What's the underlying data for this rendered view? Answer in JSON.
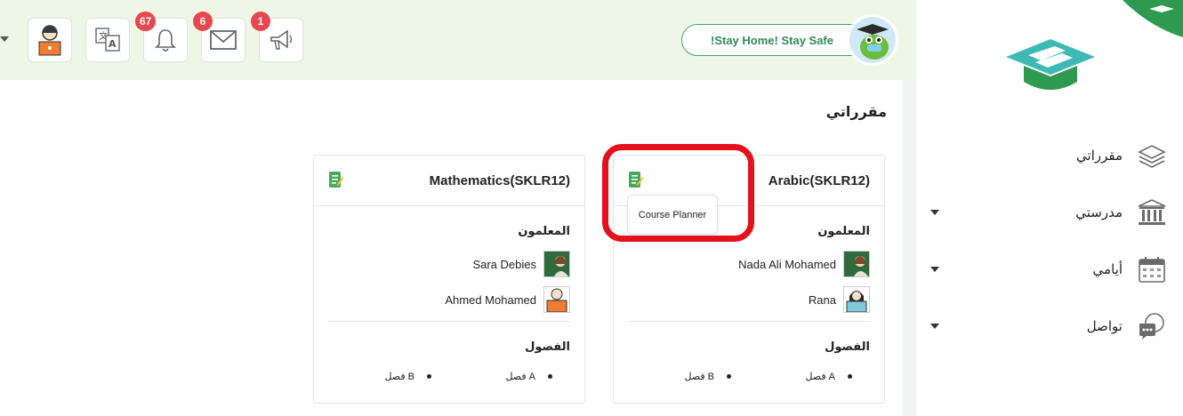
{
  "topbar": {
    "badges": {
      "notifications": "67",
      "messages": "6",
      "announcements": "1"
    },
    "stay_home": "!Stay Home! Stay Safe"
  },
  "main": {
    "title": "مقرراتي",
    "tooltip": "Course Planner",
    "courses": [
      {
        "title": "Mathematics(SKLR12)",
        "teachers_label": "المعلمون",
        "teachers": [
          "Sara Debies",
          "Ahmed Mohamed"
        ],
        "classes_label": "الفصول",
        "classes": [
          "فصل A",
          "فصل B"
        ]
      },
      {
        "title": "Arabic(SKLR12)",
        "teachers_label": "المعلمون",
        "teachers": [
          "Nada Ali Mohamed",
          "Rana"
        ],
        "classes_label": "الفصول",
        "classes": [
          "فصل A",
          "فصل B"
        ]
      }
    ]
  },
  "sidebar": {
    "items": [
      {
        "label": "مقرراتي",
        "icon": "layers-icon"
      },
      {
        "label": "مدرستي",
        "icon": "school-building-icon"
      },
      {
        "label": "أيامي",
        "icon": "calendar-icon"
      },
      {
        "label": "تواصل",
        "icon": "chat-bubbles-icon"
      }
    ]
  },
  "colors": {
    "accent": "#3aa66a",
    "highlight": "#e5101b",
    "badge": "#e8474f",
    "topbar_bg": "#eef7e5"
  }
}
